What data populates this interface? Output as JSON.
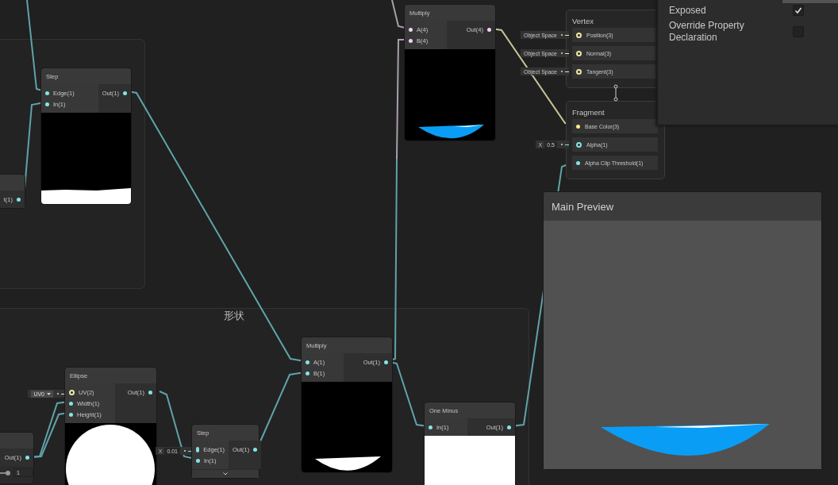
{
  "groups": [
    {
      "title": "形状"
    }
  ],
  "nodes": [
    {
      "title": "Step",
      "preview_expanded": true,
      "inputs": [
        {
          "label": "Edge(1)",
          "color": "#84e4e7",
          "connected": true
        },
        {
          "label": "In(1)",
          "color": "#84e4e7",
          "connected": true
        }
      ],
      "outputs": [
        {
          "label": "Out(1)",
          "color": "#84e4e7",
          "connected": true
        }
      ]
    },
    {
      "outputs": [
        {
          "label": "t(1)",
          "color": "#84e4e7",
          "connected": true
        }
      ]
    },
    {
      "title": "Multiply",
      "preview_expanded": true,
      "inputs": [
        {
          "label": "A(4)",
          "color": "#f1d2f1",
          "connected": true
        },
        {
          "label": "B(4)",
          "color": "#f1d2f1",
          "connected": true
        }
      ],
      "outputs": [
        {
          "label": "Out(4)",
          "color": "#f1d2f1",
          "connected": true
        }
      ]
    },
    {
      "title": "Multiply",
      "preview_expanded": true,
      "inputs": [
        {
          "label": "A(1)",
          "color": "#84e4e7",
          "connected": true
        },
        {
          "label": "B(1)",
          "color": "#84e4e7",
          "connected": true
        }
      ],
      "outputs": [
        {
          "label": "Out(1)",
          "color": "#84e4e7",
          "connected": true
        }
      ]
    },
    {
      "title": "Ellipse",
      "preview_expanded": true,
      "inputs": [
        {
          "label": "UV(2)",
          "color": "#eae8a4",
          "connected": false,
          "field": {
            "kind": "dropdown",
            "value": "UV0"
          }
        },
        {
          "label": "Width(1)",
          "color": "#84e4e7",
          "connected": true
        },
        {
          "label": "Height(1)",
          "color": "#84e4e7",
          "connected": true
        }
      ],
      "outputs": [
        {
          "label": "Out(1)",
          "color": "#84e4e7",
          "connected": true
        }
      ]
    },
    {
      "title": "Step",
      "preview_expanded": false,
      "inputs": [
        {
          "label": "Edge(1)",
          "color": "#84e4e7",
          "connected": false,
          "field": {
            "kind": "vector",
            "axis": "X",
            "value": "0.01"
          }
        },
        {
          "label": "In(1)",
          "color": "#84e4e7",
          "connected": true
        }
      ],
      "outputs": [
        {
          "label": "Out(1)",
          "color": "#84e4e7",
          "connected": true
        }
      ]
    },
    {
      "title": "One Minus",
      "preview_expanded": true,
      "inputs": [
        {
          "label": "In(1)",
          "color": "#84e4e7",
          "connected": true
        }
      ],
      "outputs": [
        {
          "label": "Out(1)",
          "color": "#84e4e7",
          "connected": true
        }
      ]
    },
    {
      "outputs": [
        {
          "label": "Out(1)",
          "color": "#84e4e7",
          "connected": true
        }
      ],
      "slider": {
        "level": 1,
        "value": "1"
      }
    }
  ],
  "blocks": [
    {
      "title": "Vertex",
      "ports": [
        {
          "label": "Position(3)",
          "color": "#eae8a4",
          "connected": false,
          "field": {
            "kind": "text",
            "value": "Object Space"
          }
        },
        {
          "label": "Normal(3)",
          "color": "#eae8a4",
          "connected": false,
          "field": {
            "kind": "text",
            "value": "Object Space"
          }
        },
        {
          "label": "Tangent(3)",
          "color": "#eae8a4",
          "connected": false,
          "field": {
            "kind": "text",
            "value": "Object Space"
          }
        }
      ]
    },
    {
      "title": "Fragment",
      "ports": [
        {
          "label": "Base Color(3)",
          "color": "#f6ef8c",
          "connected": true
        },
        {
          "label": "Alpha(1)",
          "color": "#84e4e7",
          "connected": false,
          "field": {
            "kind": "vector",
            "axis": "X",
            "value": "0.5"
          }
        },
        {
          "label": "Alpha Clip Threshold(1)",
          "color": "#84e4e7",
          "connected": true
        }
      ]
    }
  ],
  "main_preview": {
    "title": "Main Preview"
  },
  "inspector": {
    "properties": [
      {
        "label": "Exposed",
        "checked": true
      },
      {
        "label": "Override Property Declaration",
        "checked": false
      }
    ]
  }
}
